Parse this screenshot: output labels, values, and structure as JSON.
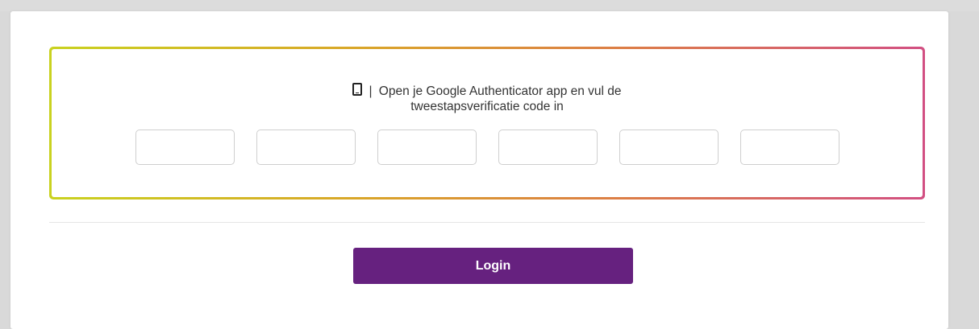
{
  "verification": {
    "instruction_line1": "Open je Google Authenticator app en vul de",
    "instruction_line2": "tweestapsverificatie code in",
    "separator": "|",
    "icon": "mobile-phone-icon",
    "code_fields": [
      {
        "value": ""
      },
      {
        "value": ""
      },
      {
        "value": ""
      },
      {
        "value": ""
      },
      {
        "value": ""
      },
      {
        "value": ""
      }
    ]
  },
  "actions": {
    "login_label": "Login"
  },
  "colors": {
    "accent": "#66217f",
    "gradient_start": "#c9d21f",
    "gradient_end": "#d24f82"
  }
}
